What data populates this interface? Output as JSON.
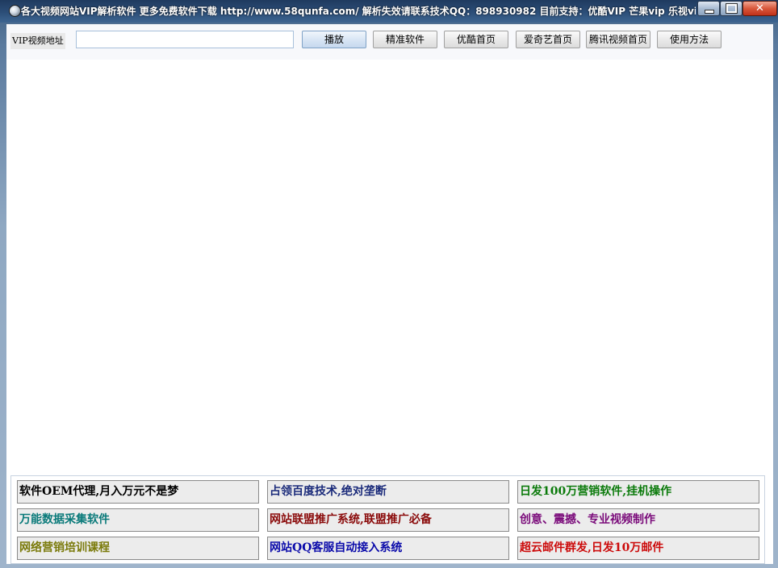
{
  "window": {
    "title": "各大视频网站VIP解析软件 更多免费软件下载 http://www.58qunfa.com/ 解析失效请联系技术QQ：898930982 目前支持：优酷VIP 芒果vip  乐视vip  ...",
    "close_symbol": "✕"
  },
  "toolbar": {
    "url_label": "VIP视频地址",
    "url_value": "",
    "buttons": {
      "play": "播放",
      "precise_software": "精准软件",
      "youku_home": "优酷首页",
      "iqiyi_home": "爱奇艺首页",
      "tencent_home": "腾讯视频首页",
      "how_to_use": "使用方法"
    }
  },
  "ads": [
    {
      "text": "软件OEM代理,月入万元不是梦",
      "color": "#000000"
    },
    {
      "text": "占领百度技术,绝对垄断",
      "color": "#1a2a7a"
    },
    {
      "text": "日发100万营销软件,挂机操作",
      "color": "#0a7a0a"
    },
    {
      "text": "万能数据采集软件",
      "color": "#0a7a7a"
    },
    {
      "text": "网站联盟推广系统,联盟推广必备",
      "color": "#8a0a0a"
    },
    {
      "text": "创意、震撼、专业视频制作",
      "color": "#7a0a7a"
    },
    {
      "text": "网络营销培训课程",
      "color": "#7a7a0a"
    },
    {
      "text": "网站QQ客服自动接入系统",
      "color": "#0a0aaa"
    },
    {
      "text": "超云邮件群发,日发10万邮件",
      "color": "#cc0a0a"
    }
  ],
  "icons": {
    "app": "globe-icon",
    "minimize": "minimize-icon",
    "maximize": "maximize-icon",
    "close": "close-icon"
  }
}
